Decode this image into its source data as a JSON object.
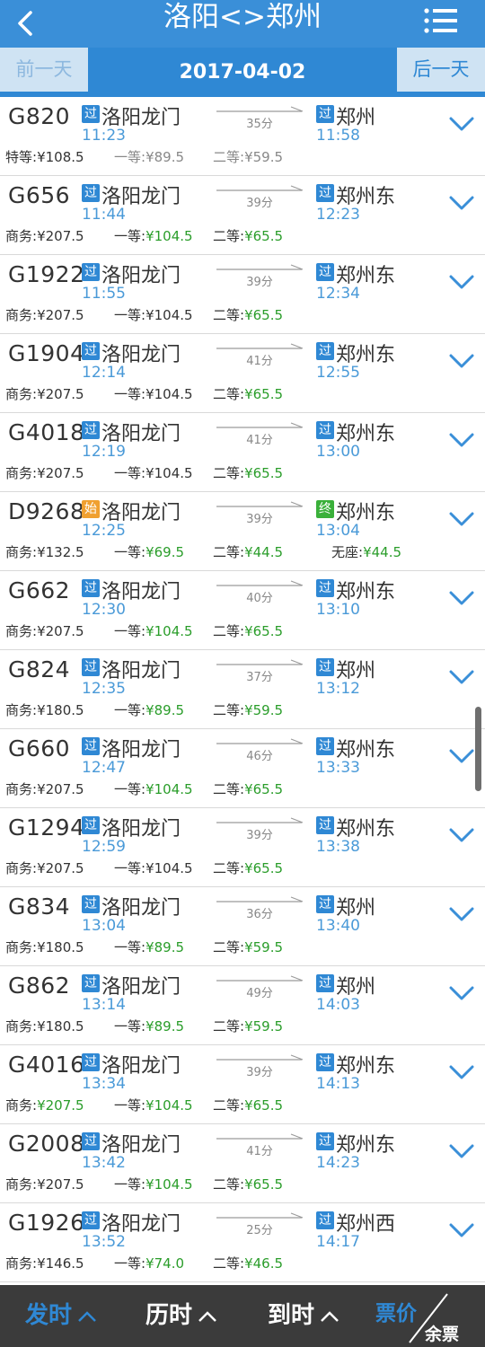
{
  "header": {
    "title": "洛阳<>郑州"
  },
  "datebar": {
    "prev": "前一天",
    "date": "2017-04-02",
    "next": "后一天"
  },
  "colors": {
    "primary": "#2f88d4",
    "green": "#2a9d2a",
    "badge_pass": "#2f88d4",
    "badge_start": "#f0a030",
    "badge_end": "#3ab03a"
  },
  "trains": [
    {
      "no": "G820",
      "from_badge": "过",
      "from_type": "pass",
      "from": "洛阳龙门",
      "dep": "11:23",
      "dur": "35分",
      "to_badge": "过",
      "to_type": "pass",
      "to": "郑州",
      "arr": "11:58",
      "p1_label": "特等:",
      "p1": "¥108.5",
      "p1c": "",
      "p2_label": "一等:",
      "p2": "¥89.5",
      "p2c": "gray",
      "p3_label": "二等:",
      "p3": "¥59.5",
      "p3c": "gray",
      "p4_label": "",
      "p4": ""
    },
    {
      "no": "G656",
      "from_badge": "过",
      "from_type": "pass",
      "from": "洛阳龙门",
      "dep": "11:44",
      "dur": "39分",
      "to_badge": "过",
      "to_type": "pass",
      "to": "郑州东",
      "arr": "12:23",
      "p1_label": "商务:",
      "p1": "¥207.5",
      "p1c": "",
      "p2_label": "一等:",
      "p2": "¥104.5",
      "p2c": "green",
      "p3_label": "二等:",
      "p3": "¥65.5",
      "p3c": "green",
      "p4_label": "",
      "p4": ""
    },
    {
      "no": "G1922",
      "from_badge": "过",
      "from_type": "pass",
      "from": "洛阳龙门",
      "dep": "11:55",
      "dur": "39分",
      "to_badge": "过",
      "to_type": "pass",
      "to": "郑州东",
      "arr": "12:34",
      "p1_label": "商务:",
      "p1": "¥207.5",
      "p1c": "",
      "p2_label": "一等:",
      "p2": "¥104.5",
      "p2c": "",
      "p3_label": "二等:",
      "p3": "¥65.5",
      "p3c": "green",
      "p4_label": "",
      "p4": ""
    },
    {
      "no": "G1904",
      "from_badge": "过",
      "from_type": "pass",
      "from": "洛阳龙门",
      "dep": "12:14",
      "dur": "41分",
      "to_badge": "过",
      "to_type": "pass",
      "to": "郑州东",
      "arr": "12:55",
      "p1_label": "商务:",
      "p1": "¥207.5",
      "p1c": "",
      "p2_label": "一等:",
      "p2": "¥104.5",
      "p2c": "",
      "p3_label": "二等:",
      "p3": "¥65.5",
      "p3c": "green",
      "p4_label": "",
      "p4": ""
    },
    {
      "no": "G4018",
      "from_badge": "过",
      "from_type": "pass",
      "from": "洛阳龙门",
      "dep": "12:19",
      "dur": "41分",
      "to_badge": "过",
      "to_type": "pass",
      "to": "郑州东",
      "arr": "13:00",
      "p1_label": "商务:",
      "p1": "¥207.5",
      "p1c": "",
      "p2_label": "一等:",
      "p2": "¥104.5",
      "p2c": "",
      "p3_label": "二等:",
      "p3": "¥65.5",
      "p3c": "green",
      "p4_label": "",
      "p4": ""
    },
    {
      "no": "D9268",
      "from_badge": "始",
      "from_type": "start",
      "from": "洛阳龙门",
      "dep": "12:25",
      "dur": "39分",
      "to_badge": "终",
      "to_type": "end",
      "to": "郑州东",
      "arr": "13:04",
      "p1_label": "商务:",
      "p1": "¥132.5",
      "p1c": "",
      "p2_label": "一等:",
      "p2": "¥69.5",
      "p2c": "green",
      "p3_label": "二等:",
      "p3": "¥44.5",
      "p3c": "green",
      "p4_label": "无座:",
      "p4": "¥44.5"
    },
    {
      "no": "G662",
      "from_badge": "过",
      "from_type": "pass",
      "from": "洛阳龙门",
      "dep": "12:30",
      "dur": "40分",
      "to_badge": "过",
      "to_type": "pass",
      "to": "郑州东",
      "arr": "13:10",
      "p1_label": "商务:",
      "p1": "¥207.5",
      "p1c": "",
      "p2_label": "一等:",
      "p2": "¥104.5",
      "p2c": "green",
      "p3_label": "二等:",
      "p3": "¥65.5",
      "p3c": "green",
      "p4_label": "",
      "p4": ""
    },
    {
      "no": "G824",
      "from_badge": "过",
      "from_type": "pass",
      "from": "洛阳龙门",
      "dep": "12:35",
      "dur": "37分",
      "to_badge": "过",
      "to_type": "pass",
      "to": "郑州",
      "arr": "13:12",
      "p1_label": "商务:",
      "p1": "¥180.5",
      "p1c": "",
      "p2_label": "一等:",
      "p2": "¥89.5",
      "p2c": "green",
      "p3_label": "二等:",
      "p3": "¥59.5",
      "p3c": "green",
      "p4_label": "",
      "p4": ""
    },
    {
      "no": "G660",
      "from_badge": "过",
      "from_type": "pass",
      "from": "洛阳龙门",
      "dep": "12:47",
      "dur": "46分",
      "to_badge": "过",
      "to_type": "pass",
      "to": "郑州东",
      "arr": "13:33",
      "p1_label": "商务:",
      "p1": "¥207.5",
      "p1c": "",
      "p2_label": "一等:",
      "p2": "¥104.5",
      "p2c": "green",
      "p3_label": "二等:",
      "p3": "¥65.5",
      "p3c": "green",
      "p4_label": "",
      "p4": ""
    },
    {
      "no": "G1294",
      "from_badge": "过",
      "from_type": "pass",
      "from": "洛阳龙门",
      "dep": "12:59",
      "dur": "39分",
      "to_badge": "过",
      "to_type": "pass",
      "to": "郑州东",
      "arr": "13:38",
      "p1_label": "商务:",
      "p1": "¥207.5",
      "p1c": "",
      "p2_label": "一等:",
      "p2": "¥104.5",
      "p2c": "",
      "p3_label": "二等:",
      "p3": "¥65.5",
      "p3c": "green",
      "p4_label": "",
      "p4": ""
    },
    {
      "no": "G834",
      "from_badge": "过",
      "from_type": "pass",
      "from": "洛阳龙门",
      "dep": "13:04",
      "dur": "36分",
      "to_badge": "过",
      "to_type": "pass",
      "to": "郑州",
      "arr": "13:40",
      "p1_label": "商务:",
      "p1": "¥180.5",
      "p1c": "",
      "p2_label": "一等:",
      "p2": "¥89.5",
      "p2c": "green",
      "p3_label": "二等:",
      "p3": "¥59.5",
      "p3c": "green",
      "p4_label": "",
      "p4": ""
    },
    {
      "no": "G862",
      "from_badge": "过",
      "from_type": "pass",
      "from": "洛阳龙门",
      "dep": "13:14",
      "dur": "49分",
      "to_badge": "过",
      "to_type": "pass",
      "to": "郑州",
      "arr": "14:03",
      "p1_label": "商务:",
      "p1": "¥180.5",
      "p1c": "",
      "p2_label": "一等:",
      "p2": "¥89.5",
      "p2c": "green",
      "p3_label": "二等:",
      "p3": "¥59.5",
      "p3c": "green",
      "p4_label": "",
      "p4": ""
    },
    {
      "no": "G4016",
      "from_badge": "过",
      "from_type": "pass",
      "from": "洛阳龙门",
      "dep": "13:34",
      "dur": "39分",
      "to_badge": "过",
      "to_type": "pass",
      "to": "郑州东",
      "arr": "14:13",
      "p1_label": "商务:",
      "p1": "¥207.5",
      "p1c": "green",
      "p2_label": "一等:",
      "p2": "¥104.5",
      "p2c": "green",
      "p3_label": "二等:",
      "p3": "¥65.5",
      "p3c": "green",
      "p4_label": "",
      "p4": ""
    },
    {
      "no": "G2008",
      "from_badge": "过",
      "from_type": "pass",
      "from": "洛阳龙门",
      "dep": "13:42",
      "dur": "41分",
      "to_badge": "过",
      "to_type": "pass",
      "to": "郑州东",
      "arr": "14:23",
      "p1_label": "商务:",
      "p1": "¥207.5",
      "p1c": "",
      "p2_label": "一等:",
      "p2": "¥104.5",
      "p2c": "green",
      "p3_label": "二等:",
      "p3": "¥65.5",
      "p3c": "green",
      "p4_label": "",
      "p4": ""
    },
    {
      "no": "G1926",
      "from_badge": "过",
      "from_type": "pass",
      "from": "洛阳龙门",
      "dep": "13:52",
      "dur": "25分",
      "to_badge": "过",
      "to_type": "pass",
      "to": "郑州西",
      "arr": "14:17",
      "p1_label": "商务:",
      "p1": "¥146.5",
      "p1c": "",
      "p2_label": "一等:",
      "p2": "¥74.0",
      "p2c": "green",
      "p3_label": "二等:",
      "p3": "¥46.5",
      "p3c": "green",
      "p4_label": "",
      "p4": ""
    }
  ],
  "bottom": {
    "depart": "发时",
    "duration": "历时",
    "arrive": "到时",
    "price": "票价",
    "remaining": "余票"
  }
}
